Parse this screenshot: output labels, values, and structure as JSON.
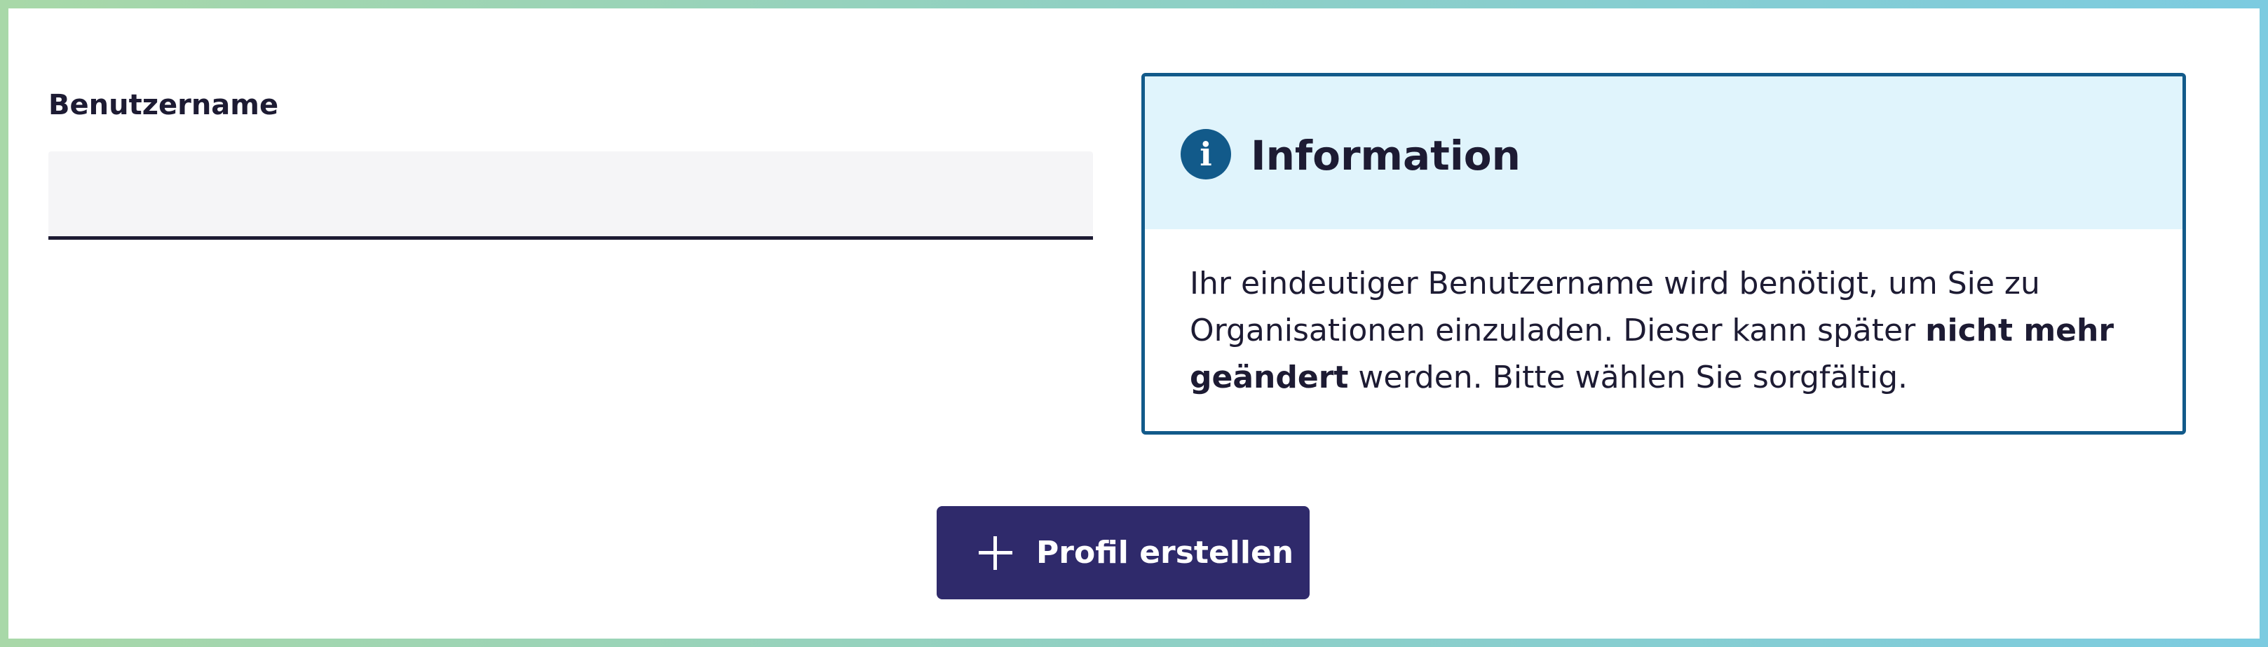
{
  "form": {
    "username_label": "Benutzername",
    "username_value": ""
  },
  "info": {
    "icon": "info-icon",
    "icon_glyph": "i",
    "title": "Information",
    "text_1": "Ihr eindeutiger Benutzername wird benötigt, um Sie zu Organisationen einzuladen. Dieser kann später ",
    "text_bold": "nicht mehr geändert",
    "text_2": " werden. Bitte wählen Sie sorgfältig."
  },
  "actions": {
    "create_profile_icon": "plus-icon",
    "create_profile_label": "Profil erstellen"
  },
  "colors": {
    "primary": "#2f2a6b",
    "info_accent": "#125a8a",
    "info_header_bg": "#e0f4fc",
    "input_bg": "#f5f5f7",
    "text": "#1d1b33"
  }
}
